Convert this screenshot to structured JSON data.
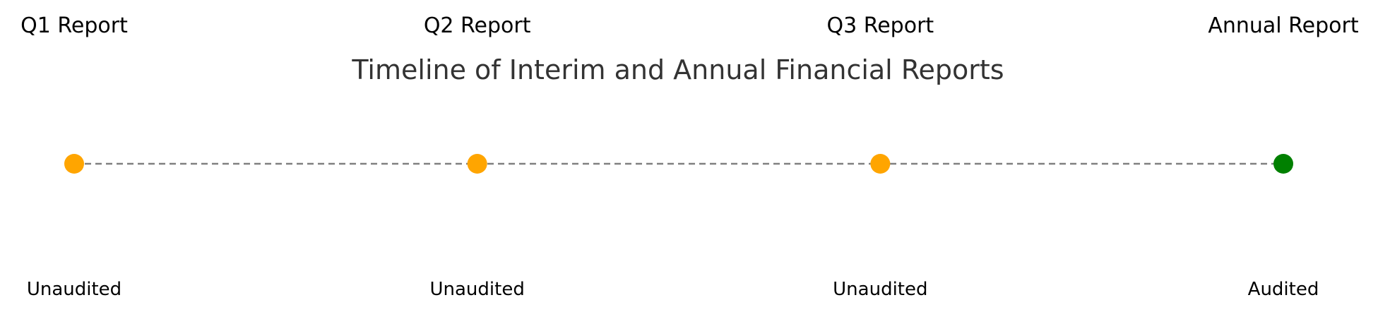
{
  "title": "Timeline of Interim and Annual Financial Reports",
  "connector_color": "#808080",
  "events": [
    {
      "label": "Q1 Report",
      "status": "Unaudited",
      "color": "#FFA500"
    },
    {
      "label": "Q2 Report",
      "status": "Unaudited",
      "color": "#FFA500"
    },
    {
      "label": "Q3 Report",
      "status": "Unaudited",
      "color": "#FFA500"
    },
    {
      "label": "Annual Report",
      "status": "Audited",
      "color": "#008000"
    }
  ]
}
